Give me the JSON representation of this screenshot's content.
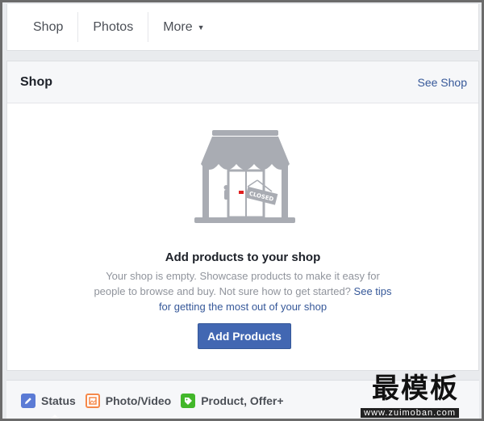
{
  "tabs": [
    {
      "label": "Shop"
    },
    {
      "label": "Photos"
    },
    {
      "label": "More",
      "has_dropdown": true
    }
  ],
  "shop_card": {
    "title": "Shop",
    "see_link": "See Shop",
    "illustration_sign": "CLOSED",
    "headline": "Add products to your shop",
    "desc_line1": "Your shop is empty. Showcase products to make it easy for",
    "desc_line2_plain": "people to browse and buy. Not sure how to get started?",
    "desc_line2_link": "See tips",
    "desc_line3_link": "for getting the most out of your shop",
    "button_label": "Add Products"
  },
  "composer": {
    "tabs": [
      {
        "label": "Status",
        "icon": "pencil-icon"
      },
      {
        "label": "Photo/Video",
        "icon": "photo-icon"
      },
      {
        "label": "Product, Offer+",
        "icon": "tag-icon"
      }
    ]
  },
  "watermark": {
    "title": "最模板",
    "url": "www.zuimoban.com"
  },
  "colors": {
    "accent": "#4267b2",
    "link": "#365899",
    "illustration": "#a9acb3",
    "background": "#e9ebee"
  }
}
